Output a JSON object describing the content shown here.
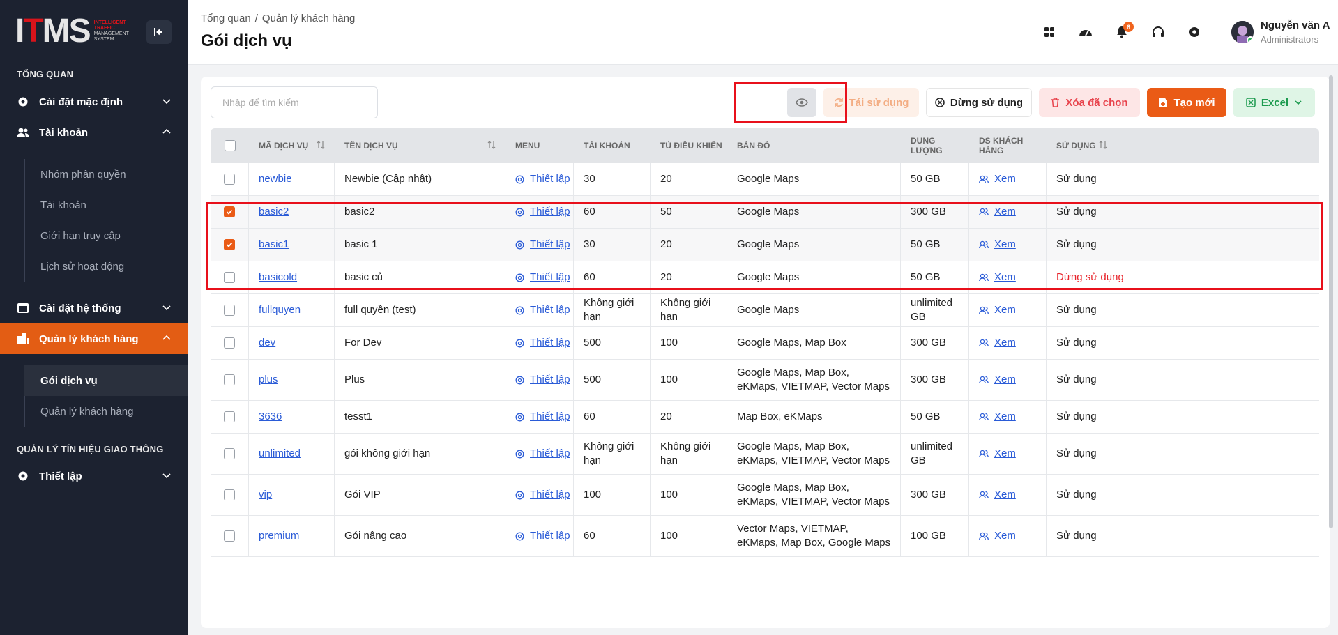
{
  "logo": {
    "main": "ITMS",
    "sub1": "INTELLIGENT",
    "sub2": "TRAFFIC",
    "sub3": "MANAGEMENT",
    "sub4": "SYSTEM"
  },
  "sidebar": {
    "section1": "TỔNG QUAN",
    "items": {
      "default_settings": "Cài đặt mặc định",
      "account": "Tài khoản",
      "system_settings": "Cài đặt hệ thống",
      "customer_mgmt": "Quản lý khách hàng",
      "setup": "Thiết lập"
    },
    "account_sub": [
      "Nhóm phân quyền",
      "Tài khoản",
      "Giới hạn truy cập",
      "Lịch sử hoạt động"
    ],
    "customer_sub": [
      "Gói dịch vụ",
      "Quản lý khách hàng"
    ],
    "section2": "QUẢN LÝ TÍN HIỆU GIAO THÔNG"
  },
  "header": {
    "crumb1": "Tổng quan",
    "crumb_sep": "/",
    "crumb2": "Quản lý khách hàng",
    "title": "Gói dịch vụ",
    "notif_count": "6",
    "user_name": "Nguyễn văn A",
    "user_role": "Administrators"
  },
  "toolbar": {
    "search_placeholder": "Nhập để tìm kiếm",
    "reuse": "Tái sử dụng",
    "stop": "Dừng sử dụng",
    "delete": "Xóa đã chọn",
    "create": "Tạo mới",
    "excel": "Excel"
  },
  "table": {
    "headers": {
      "code": "MÃ DỊCH VỤ",
      "name": "TÊN DỊCH VỤ",
      "menu": "MENU",
      "accounts": "TÀI KHOẢN",
      "cabinets": "TỦ ĐIỀU KHIỂN",
      "maps": "BẢN ĐỒ",
      "storage": "DUNG LƯỢNG",
      "customers": "DS KHÁCH HÀNG",
      "usage": "SỬ DỤNG"
    },
    "rows": [
      {
        "checked": false,
        "code": "newbie",
        "name": "Newbie (Cập nhật)",
        "menu": "Thiết lập",
        "accounts": "30",
        "cabinets": "20",
        "maps": "Google Maps",
        "storage": "50 GB",
        "customers": "Xem",
        "usage": "Sử dụng"
      },
      {
        "checked": true,
        "code": "basic2",
        "name": "basic2",
        "menu": "Thiết lập",
        "accounts": "60",
        "cabinets": "50",
        "maps": "Google Maps",
        "storage": "300 GB",
        "customers": "Xem",
        "usage": "Sử dụng"
      },
      {
        "checked": true,
        "code": "basic1",
        "name": "basic 1",
        "menu": "Thiết lập",
        "accounts": "30",
        "cabinets": "20",
        "maps": "Google Maps",
        "storage": "50 GB",
        "customers": "Xem",
        "usage": "Sử dụng"
      },
      {
        "checked": false,
        "code": "basicold",
        "name": "basic củ",
        "menu": "Thiết lập",
        "accounts": "60",
        "cabinets": "20",
        "maps": "Google Maps",
        "storage": "50 GB",
        "customers": "Xem",
        "usage": "Dừng sử dụng"
      },
      {
        "checked": false,
        "code": "fullquyen",
        "name": "full quyền (test)",
        "menu": "Thiết lập",
        "accounts": "Không giới hạn",
        "cabinets": "Không giới hạn",
        "maps": "Google Maps",
        "storage": "unlimited GB",
        "customers": "Xem",
        "usage": "Sử dụng"
      },
      {
        "checked": false,
        "code": "dev",
        "name": "For Dev",
        "menu": "Thiết lập",
        "accounts": "500",
        "cabinets": "100",
        "maps": "Google Maps, Map Box",
        "storage": "300 GB",
        "customers": "Xem",
        "usage": "Sử dụng"
      },
      {
        "checked": false,
        "code": "plus",
        "name": "Plus",
        "menu": "Thiết lập",
        "accounts": "500",
        "cabinets": "100",
        "maps": "Google Maps, Map Box, eKMaps, VIETMAP, Vector Maps",
        "storage": "300 GB",
        "customers": "Xem",
        "usage": "Sử dụng"
      },
      {
        "checked": false,
        "code": "3636",
        "name": "tesst1",
        "menu": "Thiết lập",
        "accounts": "60",
        "cabinets": "20",
        "maps": "Map Box, eKMaps",
        "storage": "50 GB",
        "customers": "Xem",
        "usage": "Sử dụng"
      },
      {
        "checked": false,
        "code": "unlimited",
        "name": "gói không giới hạn",
        "menu": "Thiết lập",
        "accounts": "Không giới hạn",
        "cabinets": "Không giới hạn",
        "maps": "Google Maps, Map Box, eKMaps, VIETMAP, Vector Maps",
        "storage": "unlimited GB",
        "customers": "Xem",
        "usage": "Sử dụng"
      },
      {
        "checked": false,
        "code": "vip",
        "name": "Gói VIP",
        "menu": "Thiết lập",
        "accounts": "100",
        "cabinets": "100",
        "maps": "Google Maps, Map Box, eKMaps, VIETMAP, Vector Maps",
        "storage": "300 GB",
        "customers": "Xem",
        "usage": "Sử dụng"
      },
      {
        "checked": false,
        "code": "premium",
        "name": "Gói nâng cao",
        "menu": "Thiết lập",
        "accounts": "60",
        "cabinets": "100",
        "maps": "Vector Maps, VIETMAP, eKMaps, Map Box, Google Maps",
        "storage": "100 GB",
        "customers": "Xem",
        "usage": "Sử dụng"
      }
    ]
  },
  "colors": {
    "accent": "#ea5b16",
    "sidebar": "#1c2230",
    "danger": "#e8262d",
    "link": "#2a5bd7",
    "highlight": "#e8101b"
  }
}
